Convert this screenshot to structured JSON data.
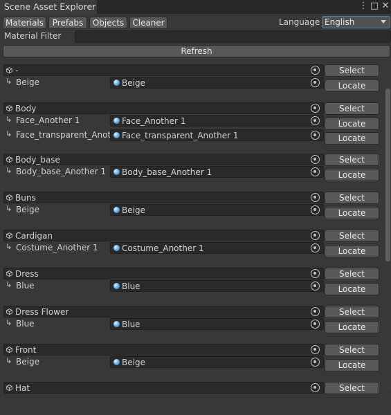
{
  "window": {
    "title": "Scene Asset Explorer",
    "menu_icon": "kebab-menu-icon",
    "maximize_icon": "maximize-icon",
    "close_icon": "close-icon"
  },
  "toolbar": {
    "tabs": [
      "Materials",
      "Prefabs",
      "Objects",
      "Cleaner"
    ],
    "language_label": "Language",
    "language_value": "English"
  },
  "filter": {
    "label": "Material Filter",
    "value": ""
  },
  "refresh_label": "Refresh",
  "select_label": "Select",
  "locate_label": "Locate",
  "groups": [
    {
      "object": "-",
      "child": "Beige",
      "material": "Beige"
    },
    {
      "object": "Body",
      "child": "Face_Another 1",
      "material": "Face_Another 1"
    },
    {
      "object": "",
      "child": "Face_transparent_Anoth",
      "material": "Face_transparent_Another 1"
    },
    {
      "object": "Body_base",
      "child": "Body_base_Another 1",
      "material": "Body_base_Another 1"
    },
    {
      "object": "Buns",
      "child": "Beige",
      "material": "Beige"
    },
    {
      "object": "Cardigan",
      "child": "Costume_Another 1",
      "material": "Costume_Another 1"
    },
    {
      "object": "Dress",
      "child": "Blue",
      "material": "Blue"
    },
    {
      "object": "Dress Flower",
      "child": "Blue",
      "material": "Blue"
    },
    {
      "object": "Front",
      "child": "Beige",
      "material": "Beige"
    },
    {
      "object": "Hat",
      "child": "",
      "material": ""
    }
  ]
}
